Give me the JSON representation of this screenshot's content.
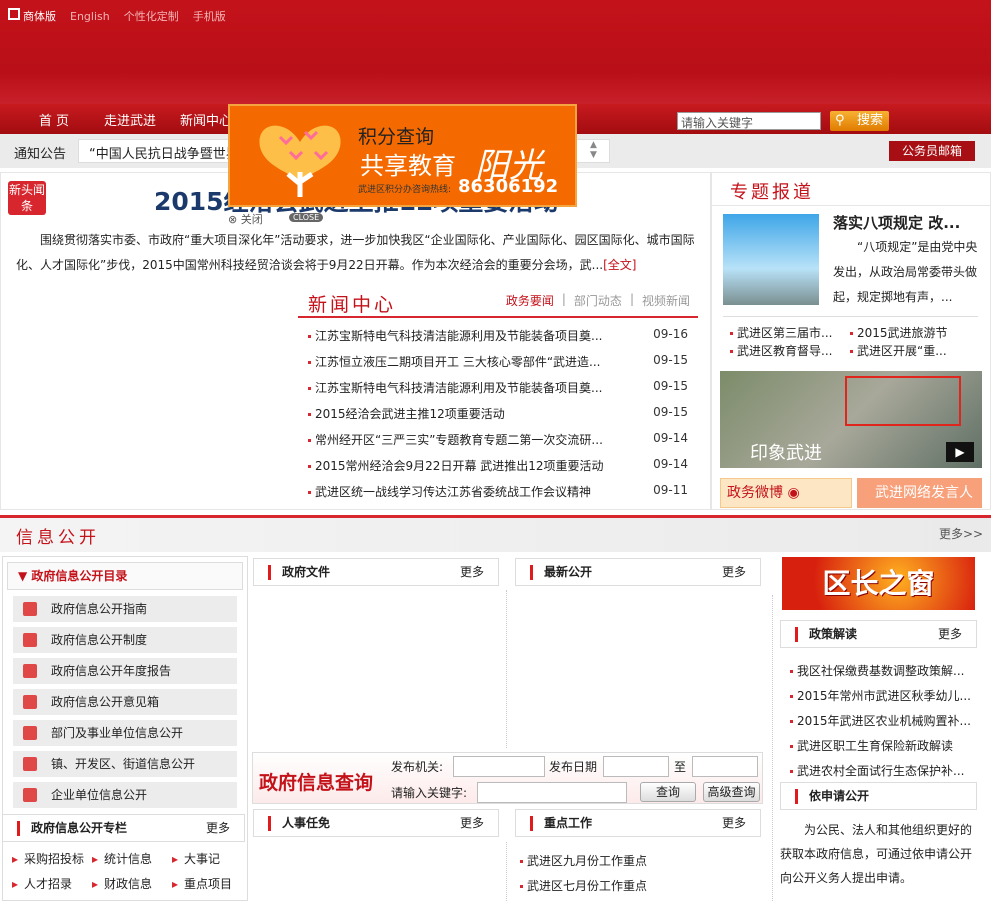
{
  "top_links": [
    "商体版",
    "English",
    "个性化定制",
    "手机版"
  ],
  "nav": [
    "首 页",
    "走进武进",
    "新闻中心"
  ],
  "search": {
    "placeholder": "请输入关键字",
    "button": "搜索"
  },
  "notice": {
    "label": "通知公告",
    "text": "“中国人民抗日战争暨世界反法西斯战争胜利70周年”",
    "mail": "公务员邮箱"
  },
  "ad": {
    "line1": "积分查询",
    "line2": "共享教育",
    "line3": "阳光",
    "hotline_label": "武进区积分办咨询热线:",
    "hotline": "86306192",
    "close": "关闭",
    "close_en": "CLOSE"
  },
  "headline": {
    "badge": "新头闻条",
    "title": "2015经洽会武进主推12项重要活动",
    "summary": "围绕贯彻落实市委、市政府“重大项目深化年”活动要求，进一步加快我区“企业国际化、产业国际化、园区国际化、城市国际化、人才国际化”步伐，2015中国常州科技经贸洽谈会将于9月22日开幕。作为本次经洽会的重要分会场，武...",
    "more": "[全文]"
  },
  "news_center": {
    "title": "新闻中心",
    "tabs": [
      "政务要闻",
      "部门动态",
      "视频新闻"
    ],
    "items": [
      {
        "title": "江苏宝斯特电气科技清洁能源利用及节能装备项目奠...",
        "date": "09-16"
      },
      {
        "title": "江苏恒立液压二期项目开工 三大核心零部件“武进造...",
        "date": "09-15"
      },
      {
        "title": "江苏宝斯特电气科技清洁能源利用及节能装备项目奠...",
        "date": "09-15"
      },
      {
        "title": "2015经洽会武进主推12项重要活动",
        "date": "09-15"
      },
      {
        "title": "常州经开区“三严三实”专题教育专题二第一次交流研...",
        "date": "09-14"
      },
      {
        "title": "2015常州经洽会9月22日开幕 武进推出12项重要活动",
        "date": "09-14"
      },
      {
        "title": "武进区统一战线学习传达江苏省委统战工作会议精神",
        "date": "09-11"
      }
    ]
  },
  "special": {
    "title": "专题报道",
    "headline": "落实八项规定 改...",
    "summary": "“八项规定”是由党中央发出，从政治局常委带头做起，规定掷地有声，...",
    "links": [
      "武进区第三届市...",
      "2015武进旅游节",
      "武进区教育督导...",
      "武进区开展“重..."
    ],
    "image_caption": "印象武进",
    "weibo": "政务微博",
    "spokesman": "武进网络发言人"
  },
  "info": {
    "title": "信息公开",
    "more": "更多>>",
    "catalog_title": "政府信息公开目录",
    "catalog": [
      "政府信息公开指南",
      "政府信息公开制度",
      "政府信息公开年度报告",
      "政府信息公开意见箱",
      "部门及事业单位信息公开",
      "镇、开发区、街道信息公开",
      "企业单位信息公开"
    ],
    "column": {
      "title": "政府信息公开专栏",
      "more": "更多",
      "links": [
        "采购招投标",
        "统计信息",
        "大事记",
        "人才招录",
        "财政信息",
        "重点项目"
      ]
    },
    "boxes": {
      "docs": "政府文件",
      "latest": "最新公开",
      "personnel": "人事任免",
      "keywork": "重点工作",
      "more": "更多"
    },
    "keywork_items": [
      "武进区九月份工作重点",
      "武进区七月份工作重点"
    ],
    "query": {
      "title": "政府信息查询",
      "org": "发布机关:",
      "date": "发布日期",
      "to": "至",
      "keyword": "请输入关键字:",
      "search": "查询",
      "advanced": "高级查询"
    }
  },
  "right": {
    "window": "区长之窗",
    "policy": {
      "title": "政策解读",
      "more": "更多",
      "items": [
        "我区社保缴费基数调整政策解...",
        "2015年常州市武进区秋季幼儿...",
        "2015年武进区农业机械购置补...",
        "武进区职工生育保险新政解读",
        "武进农村全面试行生态保护补..."
      ]
    },
    "apply": {
      "title": "依申请公开",
      "text": "为公民、法人和其他组织更好的获取本政府信息，可通过依申请公开向公开义务人提出申请。"
    }
  }
}
